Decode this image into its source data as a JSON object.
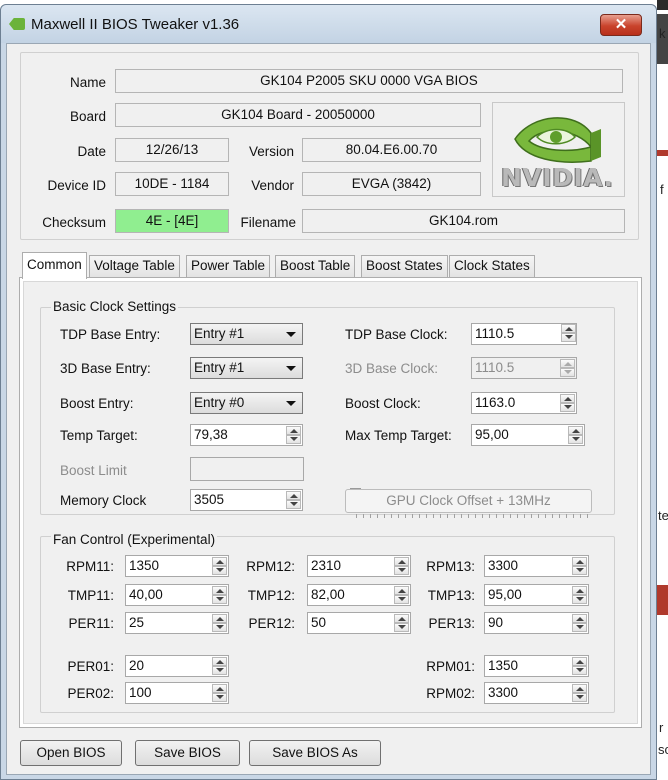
{
  "window": {
    "title": "Maxwell II BIOS Tweaker v1.36",
    "close_glyph": "✕"
  },
  "info": {
    "name_label": "Name",
    "name_value": "GK104 P2005 SKU 0000 VGA BIOS",
    "board_label": "Board",
    "board_value": "GK104 Board - 20050000",
    "date_label": "Date",
    "date_value": "12/26/13",
    "version_label": "Version",
    "version_value": "80.04.E6.00.70",
    "device_label": "Device ID",
    "device_value": "10DE - 1184",
    "vendor_label": "Vendor",
    "vendor_value": "EVGA (3842)",
    "checksum_label": "Checksum",
    "checksum_value": "4E - [4E]",
    "filename_label": "Filename",
    "filename_value": "GK104.rom",
    "logo_text": "NVIDIA."
  },
  "tabs": [
    {
      "label": "Common",
      "active": true
    },
    {
      "label": "Voltage Table"
    },
    {
      "label": "Power Table"
    },
    {
      "label": "Boost Table"
    },
    {
      "label": "Boost States"
    },
    {
      "label": "Clock States"
    }
  ],
  "basic": {
    "title": "Basic Clock Settings",
    "tdp_entry_label": "TDP Base Entry:",
    "tdp_entry_value": "Entry #1",
    "d3_entry_label": "3D Base Entry:",
    "d3_entry_value": "Entry #1",
    "boost_entry_label": "Boost Entry:",
    "boost_entry_value": "Entry #0",
    "temp_target_label": "Temp Target:",
    "temp_target_value": "79,38",
    "boost_limit_label": "Boost Limit",
    "memory_clock_label": "Memory Clock",
    "memory_clock_value": "3505",
    "tdp_clock_label": "TDP Base Clock:",
    "tdp_clock_value": "1110.5",
    "d3_clock_label": "3D Base Clock:",
    "d3_clock_value": "1110.5",
    "boost_clock_label": "Boost Clock:",
    "boost_clock_value": "1163.0",
    "max_temp_label": "Max Temp Target:",
    "max_temp_value": "95,00",
    "offset_button": "GPU Clock Offset + 13MHz"
  },
  "fan": {
    "title": "Fan Control (Experimental)",
    "rpm11_label": "RPM11:",
    "rpm11_value": "1350",
    "rpm12_label": "RPM12:",
    "rpm12_value": "2310",
    "rpm13_label": "RPM13:",
    "rpm13_value": "3300",
    "tmp11_label": "TMP11:",
    "tmp11_value": "40,00",
    "tmp12_label": "TMP12:",
    "tmp12_value": "82,00",
    "tmp13_label": "TMP13:",
    "tmp13_value": "95,00",
    "per11_label": "PER11:",
    "per11_value": "25",
    "per12_label": "PER12:",
    "per12_value": "50",
    "per13_label": "PER13:",
    "per13_value": "90",
    "per01_label": "PER01:",
    "per01_value": "20",
    "per02_label": "PER02:",
    "per02_value": "100",
    "rpm01_label": "RPM01:",
    "rpm01_value": "1350",
    "rpm02_label": "RPM02:",
    "rpm02_value": "3300"
  },
  "buttons": {
    "open": "Open BIOS",
    "save": "Save BIOS",
    "save_as": "Save BIOS As"
  },
  "background": {
    "frag1": "k",
    "frag2": "f",
    "frag3": "te",
    "frag4": "r",
    "frag5": "sc"
  }
}
